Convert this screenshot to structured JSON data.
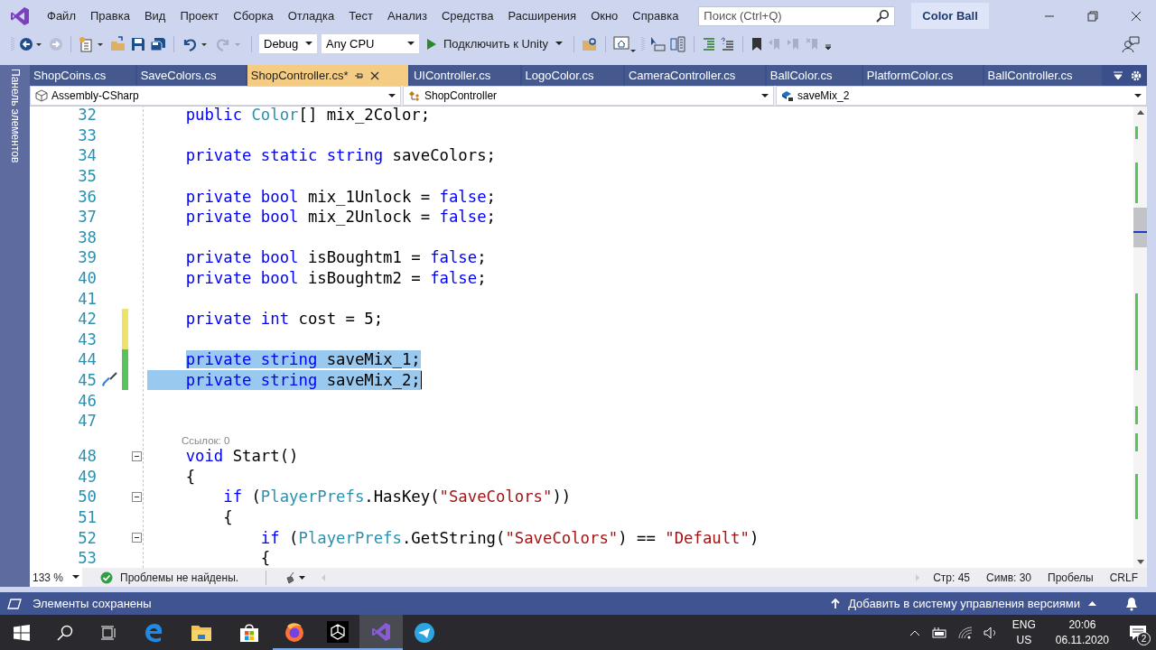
{
  "menu": [
    "Файл",
    "Правка",
    "Вид",
    "Проект",
    "Сборка",
    "Отладка",
    "Тест",
    "Анализ",
    "Средства",
    "Расширения",
    "Окно",
    "Справка"
  ],
  "search": {
    "placeholder": "Поиск (Ctrl+Q)"
  },
  "solution_name": "Color Ball",
  "toolbar": {
    "configuration": "Debug",
    "platform": "Any CPU",
    "run_label": "Подключить к Unity"
  },
  "tool_window_tab": "Панель элементов",
  "tabs": [
    {
      "label": "ShopCoins.cs",
      "selected": false
    },
    {
      "label": "SaveColors.cs",
      "selected": false
    },
    {
      "label": "ShopController.cs*",
      "selected": true
    },
    {
      "label": "UIController.cs",
      "selected": false
    },
    {
      "label": "LogoColor.cs",
      "selected": false
    },
    {
      "label": "CameraController.cs",
      "selected": false
    },
    {
      "label": "BallColor.cs",
      "selected": false
    },
    {
      "label": "PlatformColor.cs",
      "selected": false
    },
    {
      "label": "BallController.cs",
      "selected": false
    }
  ],
  "nav_bar": {
    "project": "Assembly-CSharp",
    "type": "ShopController",
    "member": "saveMix_2"
  },
  "code_lines": [
    {
      "kind": "code",
      "number": "32",
      "fold": false,
      "selected": false,
      "caret": false,
      "quick_action": false,
      "tokens": [
        {
          "kind": "keyword",
          "text": "    public"
        },
        {
          "kind": "type",
          "text": " Color"
        },
        {
          "kind": "plain",
          "text": "[] mix_2Color;"
        }
      ]
    },
    {
      "kind": "code",
      "number": "33",
      "fold": false,
      "selected": false,
      "caret": false,
      "quick_action": false
    },
    {
      "kind": "code",
      "number": "34",
      "fold": false,
      "selected": false,
      "caret": false,
      "quick_action": false,
      "tokens": [
        {
          "kind": "keyword",
          "text": "    private static string"
        },
        {
          "kind": "plain",
          "text": " saveColors;"
        }
      ]
    },
    {
      "kind": "code",
      "number": "35",
      "fold": false,
      "selected": false,
      "caret": false,
      "quick_action": false
    },
    {
      "kind": "code",
      "number": "36",
      "fold": false,
      "selected": false,
      "caret": false,
      "quick_action": false,
      "tokens": [
        {
          "kind": "keyword",
          "text": "    private bool"
        },
        {
          "kind": "plain",
          "text": " mix_1Unlock = "
        },
        {
          "kind": "keyword",
          "text": "false"
        },
        {
          "kind": "plain",
          "text": ";"
        }
      ]
    },
    {
      "kind": "code",
      "number": "37",
      "fold": false,
      "selected": false,
      "caret": false,
      "quick_action": false,
      "tokens": [
        {
          "kind": "keyword",
          "text": "    private bool"
        },
        {
          "kind": "plain",
          "text": " mix_2Unlock = "
        },
        {
          "kind": "keyword",
          "text": "false"
        },
        {
          "kind": "plain",
          "text": ";"
        }
      ]
    },
    {
      "kind": "code",
      "number": "38",
      "fold": false,
      "selected": false,
      "caret": false,
      "quick_action": false
    },
    {
      "kind": "code",
      "number": "39",
      "fold": false,
      "selected": false,
      "caret": false,
      "quick_action": false,
      "tokens": [
        {
          "kind": "keyword",
          "text": "    private bool"
        },
        {
          "kind": "plain",
          "text": " isBoughtm1 = "
        },
        {
          "kind": "keyword",
          "text": "false"
        },
        {
          "kind": "plain",
          "text": ";"
        }
      ]
    },
    {
      "kind": "code",
      "number": "40",
      "fold": false,
      "selected": false,
      "caret": false,
      "quick_action": false,
      "tokens": [
        {
          "kind": "keyword",
          "text": "    private bool"
        },
        {
          "kind": "plain",
          "text": " isBoughtm2 = "
        },
        {
          "kind": "keyword",
          "text": "false"
        },
        {
          "kind": "plain",
          "text": ";"
        }
      ]
    },
    {
      "kind": "code",
      "number": "41",
      "fold": false,
      "selected": false,
      "caret": false,
      "quick_action": false
    },
    {
      "kind": "code",
      "number": "42",
      "color": "#eee36a",
      "fold": false,
      "selected": false,
      "caret": false,
      "quick_action": false,
      "tokens": [
        {
          "kind": "keyword",
          "text": "    private int"
        },
        {
          "kind": "plain",
          "text": " cost = 5;"
        }
      ]
    },
    {
      "kind": "code",
      "number": "43",
      "color": "#eee36a",
      "fold": false,
      "selected": false,
      "caret": false,
      "quick_action": false
    },
    {
      "kind": "code",
      "number": "44",
      "color": "#57c35a",
      "fold": false,
      "selected": true,
      "caret": false,
      "quick_action": false,
      "tokens": [
        {
          "kind": "keyword",
          "text": "    private string"
        },
        {
          "kind": "plain",
          "text": " saveMix_1;"
        }
      ]
    },
    {
      "kind": "code",
      "number": "45",
      "color": "#57c35a",
      "fold": false,
      "selected": true,
      "caret": true,
      "quick_action": true,
      "tokens": [
        {
          "kind": "keyword",
          "text": "    private string"
        },
        {
          "kind": "plain",
          "text": " saveMix_2;"
        }
      ]
    },
    {
      "kind": "code",
      "number": "46",
      "fold": false,
      "selected": false,
      "caret": false,
      "quick_action": false
    },
    {
      "kind": "code",
      "number": "47",
      "fold": false,
      "selected": false,
      "caret": false,
      "quick_action": false
    },
    {
      "kind": "codelens",
      "text": "Ссылок: 0"
    },
    {
      "kind": "code",
      "number": "48",
      "fold": true,
      "selected": false,
      "caret": false,
      "quick_action": false,
      "tokens": [
        {
          "kind": "keyword",
          "text": "    void"
        },
        {
          "kind": "plain",
          "text": " Start()"
        }
      ]
    },
    {
      "kind": "code",
      "number": "49",
      "fold": false,
      "selected": false,
      "caret": false,
      "quick_action": false,
      "tokens": [
        {
          "kind": "plain",
          "text": "    {"
        }
      ]
    },
    {
      "kind": "code",
      "number": "50",
      "fold": true,
      "selected": false,
      "caret": false,
      "quick_action": false,
      "tokens": [
        {
          "kind": "keyword",
          "text": "        if"
        },
        {
          "kind": "plain",
          "text": " ("
        },
        {
          "kind": "type",
          "text": "PlayerPrefs"
        },
        {
          "kind": "plain",
          "text": ".HasKey("
        },
        {
          "kind": "string",
          "text": "\"SaveColors\""
        },
        {
          "kind": "plain",
          "text": "))"
        }
      ]
    },
    {
      "kind": "code",
      "number": "51",
      "fold": false,
      "selected": false,
      "caret": false,
      "quick_action": false,
      "tokens": [
        {
          "kind": "plain",
          "text": "        {"
        }
      ]
    },
    {
      "kind": "code",
      "number": "52",
      "fold": true,
      "selected": false,
      "caret": false,
      "quick_action": false,
      "tokens": [
        {
          "kind": "keyword",
          "text": "            if"
        },
        {
          "kind": "plain",
          "text": " ("
        },
        {
          "kind": "type",
          "text": "PlayerPrefs"
        },
        {
          "kind": "plain",
          "text": ".GetString("
        },
        {
          "kind": "string",
          "text": "\"SaveColors\""
        },
        {
          "kind": "plain",
          "text": ") == "
        },
        {
          "kind": "string",
          "text": "\"Default\""
        },
        {
          "kind": "plain",
          "text": ")"
        }
      ]
    },
    {
      "kind": "code",
      "number": "53",
      "fold": false,
      "selected": false,
      "caret": false,
      "quick_action": false,
      "tokens": [
        {
          "kind": "plain",
          "text": "            {"
        }
      ]
    }
  ],
  "editor_status": {
    "zoom": "133 %",
    "problems": "Проблемы не найдены.",
    "line": "Стр: 45",
    "column": "Симв: 30",
    "indent_mode": "Пробелы",
    "line_endings": "CRLF"
  },
  "status_bar": {
    "message": "Элементы сохранены",
    "source_control": "Добавить в систему управления версиями"
  },
  "taskbar": {
    "language": "ENG",
    "layout": "US",
    "time": "20:06",
    "date": "06.11.2020",
    "notifications": "2"
  }
}
